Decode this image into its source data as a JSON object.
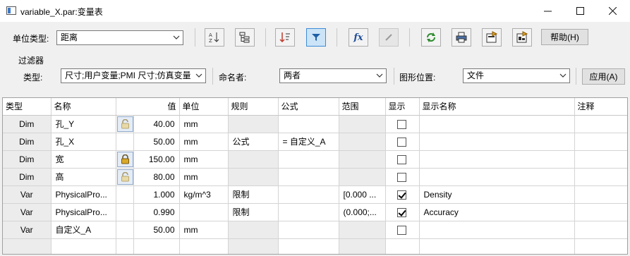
{
  "window": {
    "title": "variable_X.par:变量表"
  },
  "toolbar": {
    "unit_type_label": "单位类型:",
    "unit_type_value": "距离",
    "help_label": "帮助(H)",
    "fx_label": "fx"
  },
  "filter": {
    "group_label": "过滤器",
    "type_label": "类型:",
    "type_value": "尺寸;用户变量;PMI 尺寸;仿真变量",
    "naming_label": "命名者:",
    "naming_value": "两者",
    "location_label": "图形位置:",
    "location_value": "文件",
    "apply_label": "应用(A)"
  },
  "table": {
    "columns": [
      "类型",
      "名称",
      "值",
      "单位",
      "规则",
      "公式",
      "范围",
      "显示",
      "显示名称",
      "注释"
    ],
    "rows": [
      {
        "type": "Dim",
        "name": "孔_Y",
        "lock": "unlocked",
        "value": "40.00",
        "unit": "mm",
        "rule": "",
        "formula": "",
        "range": "",
        "show": false,
        "display_name": "",
        "note": ""
      },
      {
        "type": "Dim",
        "name": "孔_X",
        "lock": "",
        "value": "50.00",
        "unit": "mm",
        "rule": "公式",
        "formula": "= 自定义_A",
        "range": "",
        "show": false,
        "display_name": "",
        "note": ""
      },
      {
        "type": "Dim",
        "name": "宽",
        "lock": "locked",
        "value": "150.00",
        "unit": "mm",
        "rule": "",
        "formula": "",
        "range": "",
        "show": false,
        "display_name": "",
        "note": ""
      },
      {
        "type": "Dim",
        "name": "高",
        "lock": "unlocked",
        "value": "80.00",
        "unit": "mm",
        "rule": "",
        "formula": "",
        "range": "",
        "show": false,
        "display_name": "",
        "note": ""
      },
      {
        "type": "Var",
        "name": "PhysicalPro...",
        "lock": "",
        "value": "1.000",
        "unit": "kg/m^3",
        "rule": "限制",
        "formula": "",
        "range": "[0.000 ...",
        "show": true,
        "display_name": "Density",
        "note": ""
      },
      {
        "type": "Var",
        "name": "PhysicalPro...",
        "lock": "",
        "value": "0.990",
        "unit": "",
        "rule": "限制",
        "formula": "",
        "range": "(0.000;...",
        "show": true,
        "display_name": "Accuracy",
        "note": ""
      },
      {
        "type": "Var",
        "name": "自定义_A",
        "lock": "",
        "value": "50.00",
        "unit": "mm",
        "rule": "",
        "formula": "",
        "range": "",
        "show": false,
        "display_name": "",
        "note": ""
      }
    ]
  },
  "colors": {
    "accent": "#3c8cd6",
    "gray_cell": "#ececec",
    "titlebar": "#ffffff"
  }
}
